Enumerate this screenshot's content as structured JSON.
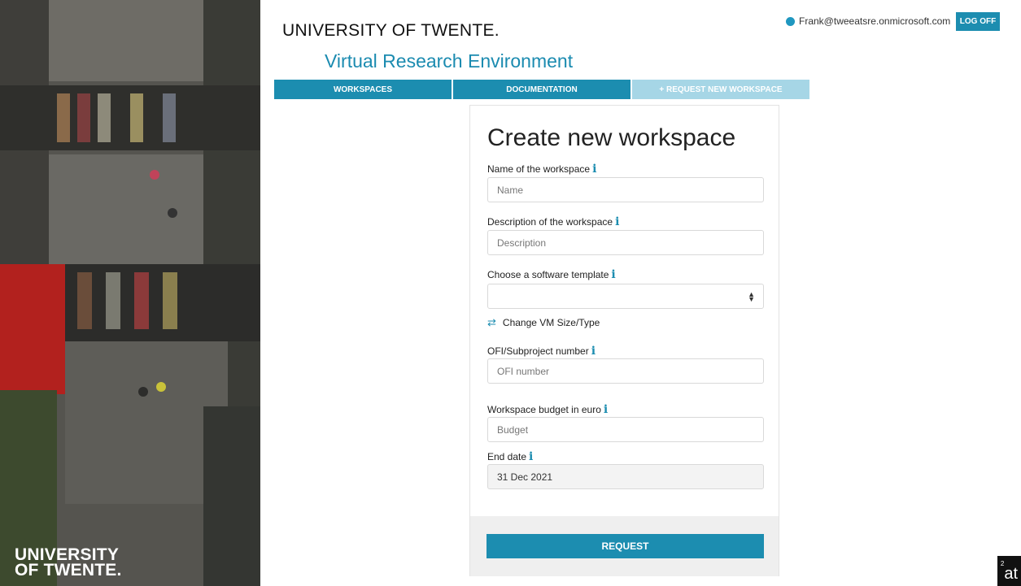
{
  "header": {
    "brand": "UNIVERSITY OF TWENTE.",
    "subtitle": "Virtual Research Environment",
    "user_email": "Frank@tweeatsre.onmicrosoft.com",
    "logoff_label": "LOG OFF"
  },
  "photo_logo": {
    "line1": "UNIVERSITY",
    "line2": "OF TWENTE."
  },
  "nav": {
    "tabs": [
      {
        "label": "WORKSPACES"
      },
      {
        "label": "DOCUMENTATION"
      },
      {
        "label": "+ REQUEST NEW WORKSPACE"
      }
    ]
  },
  "form": {
    "title": "Create new workspace",
    "name": {
      "label": "Name of the workspace",
      "placeholder": "Name"
    },
    "description": {
      "label": "Description of the workspace",
      "placeholder": "Description"
    },
    "template": {
      "label": "Choose a software template",
      "value": ""
    },
    "change_vm": "Change VM Size/Type",
    "ofi": {
      "label": "OFI/Subproject number",
      "placeholder": "OFI number"
    },
    "budget": {
      "label": "Workspace budget in euro",
      "placeholder": "Budget"
    },
    "end_date": {
      "label": "End date",
      "value": "31 Dec 2021"
    },
    "info_glyph": "i",
    "submit_label": "REQUEST"
  },
  "corner_badge": {
    "sup": "2",
    "text": "at"
  },
  "colors": {
    "accent": "#1c8db0",
    "accent_light": "#a6d6e6"
  }
}
